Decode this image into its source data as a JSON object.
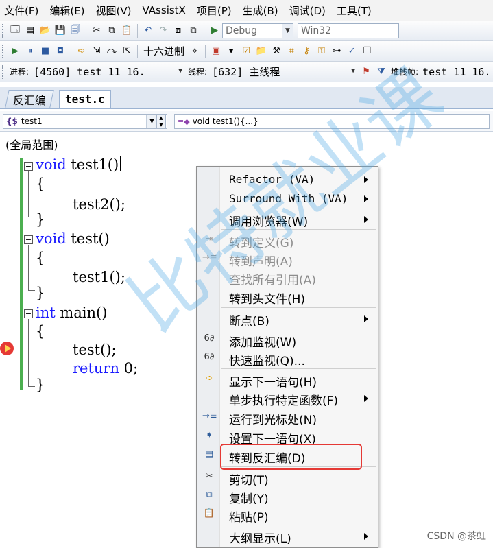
{
  "menubar": {
    "items": [
      "文件(F)",
      "编辑(E)",
      "视图(V)",
      "VAssistX",
      "项目(P)",
      "生成(B)",
      "调试(D)",
      "工具(T)"
    ]
  },
  "toolbar1": {
    "config": "Debug",
    "platform": "Win32"
  },
  "toolbar2": {
    "hex_label": "十六进制"
  },
  "debug_location": {
    "process_label": "进程:",
    "process_value": "[4560] test_11_16.",
    "thread_label": "线程:",
    "thread_value": "[632] 主线程",
    "stack_label": "堆栈帧:",
    "stack_value": "test_11_16."
  },
  "tabs": [
    {
      "label": "反汇编"
    },
    {
      "label": "test.c"
    }
  ],
  "navbar": {
    "scope_combo": "test1",
    "member_combo": "void test1(){...}"
  },
  "scope_label": "(全局范围)",
  "code": {
    "lines": [
      {
        "kw": "void",
        "rest": " test1()"
      },
      {
        "kw": "",
        "rest": "{"
      },
      {
        "kw": "",
        "rest": "test2();"
      },
      {
        "kw": "",
        "rest": "}"
      },
      {
        "kw": "void",
        "rest": " test()"
      },
      {
        "kw": "",
        "rest": "{"
      },
      {
        "kw": "",
        "rest": "test1();"
      },
      {
        "kw": "",
        "rest": "}"
      },
      {
        "kw": "int",
        "rest": " main()"
      },
      {
        "kw": "",
        "rest": "{"
      },
      {
        "kw": "",
        "rest": "test();"
      },
      {
        "kw": "return",
        "rest": " 0;"
      },
      {
        "kw": "",
        "rest": "}"
      }
    ]
  },
  "context_menu": {
    "items": [
      {
        "label": "Refactor (VA)",
        "submenu": true,
        "disabled": false,
        "icon": ""
      },
      {
        "label": "Surround With (VA)",
        "submenu": true,
        "disabled": false,
        "icon": ""
      },
      {
        "label": "调用浏览器(W)",
        "submenu": true,
        "disabled": false,
        "icon": ""
      },
      {
        "label": "转到定义(G)",
        "submenu": false,
        "disabled": true,
        "icon": "goto-definition-icon"
      },
      {
        "label": "转到声明(A)",
        "submenu": false,
        "disabled": true,
        "icon": "goto-declaration-icon"
      },
      {
        "label": "查找所有引用(A)",
        "submenu": false,
        "disabled": true,
        "icon": ""
      },
      {
        "label": "转到头文件(H)",
        "submenu": false,
        "disabled": false,
        "icon": ""
      },
      {
        "label": "断点(B)",
        "submenu": true,
        "disabled": false,
        "icon": ""
      },
      {
        "label": "添加监视(W)",
        "submenu": false,
        "disabled": false,
        "icon": "watch-glasses-icon"
      },
      {
        "label": "快速监视(Q)...",
        "submenu": false,
        "disabled": false,
        "icon": "quickwatch-glasses-icon"
      },
      {
        "label": "显示下一语句(H)",
        "submenu": false,
        "disabled": false,
        "icon": "next-statement-arrow-icon"
      },
      {
        "label": "单步执行特定函数(F)",
        "submenu": true,
        "disabled": false,
        "icon": ""
      },
      {
        "label": "运行到光标处(N)",
        "submenu": false,
        "disabled": false,
        "icon": "run-to-cursor-icon"
      },
      {
        "label": "设置下一语句(X)",
        "submenu": false,
        "disabled": false,
        "icon": "set-next-statement-icon"
      },
      {
        "label": "转到反汇编(D)",
        "submenu": false,
        "disabled": false,
        "icon": "disassembly-icon"
      },
      {
        "label": "剪切(T)",
        "submenu": false,
        "disabled": false,
        "icon": "scissors-icon"
      },
      {
        "label": "复制(Y)",
        "submenu": false,
        "disabled": false,
        "icon": "copy-icon"
      },
      {
        "label": "粘贴(P)",
        "submenu": false,
        "disabled": false,
        "icon": "paste-icon"
      },
      {
        "label": "大纲显示(L)",
        "submenu": true,
        "disabled": false,
        "icon": ""
      }
    ]
  },
  "watermark": "比特就业课",
  "credit": "CSDN @茶虹",
  "colors": {
    "keyword": "#1a1aff",
    "highlight_border": "#e53935",
    "change_bar": "#4caf50"
  }
}
